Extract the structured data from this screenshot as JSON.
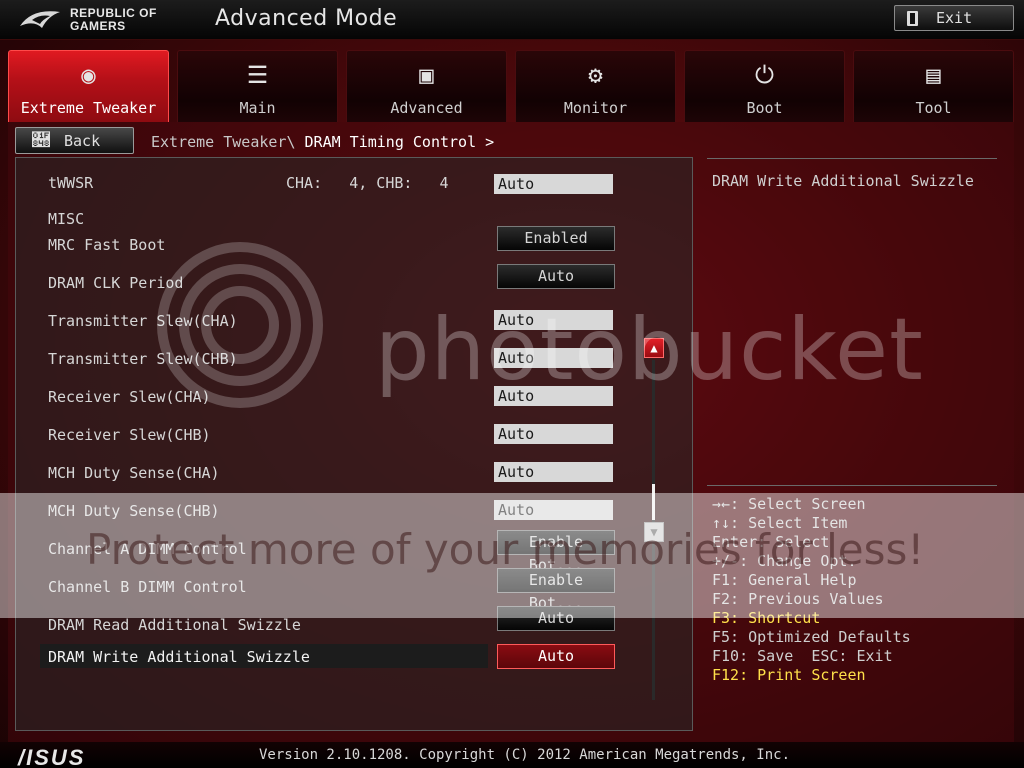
{
  "header": {
    "brand_line1": "REPUBLIC OF",
    "brand_line2": "GAMERS",
    "mode_title": "Advanced Mode",
    "exit_label": "Exit"
  },
  "tabs": [
    {
      "label": "Extreme Tweaker",
      "icon": "tweaker-icon",
      "active": true
    },
    {
      "label": "Main",
      "icon": "list-icon",
      "active": false
    },
    {
      "label": "Advanced",
      "icon": "advanced-icon",
      "active": false
    },
    {
      "label": "Monitor",
      "icon": "gauge-icon",
      "active": false
    },
    {
      "label": "Boot",
      "icon": "power-icon",
      "active": false
    },
    {
      "label": "Tool",
      "icon": "toolbox-icon",
      "active": false
    }
  ],
  "nav": {
    "back_label": "Back",
    "breadcrumb_parent": "Extreme Tweaker\\",
    "breadcrumb_current": "DRAM Timing Control >"
  },
  "settings": {
    "twwsr": {
      "label": "tWWSR",
      "cha_chb": "CHA:   4, CHB:   4",
      "value": "Auto"
    },
    "misc_heading": "MISC",
    "rows": [
      {
        "label": "MRC Fast Boot",
        "value": "Enabled"
      },
      {
        "label": "DRAM CLK Period",
        "value": "Auto"
      },
      {
        "label": "Transmitter Slew(CHA)",
        "value": "Auto"
      },
      {
        "label": "Transmitter Slew(CHB)",
        "value": "Auto"
      },
      {
        "label": "Receiver Slew(CHA)",
        "value": "Auto"
      },
      {
        "label": "Receiver Slew(CHB)",
        "value": "Auto"
      },
      {
        "label": "MCH Duty Sense(CHA)",
        "value": "Auto"
      },
      {
        "label": "MCH Duty Sense(CHB)",
        "value": "Auto"
      },
      {
        "label": "Channel A DIMM Control",
        "value": "Enable Bot..."
      },
      {
        "label": "Channel B DIMM Control",
        "value": "Enable Bot..."
      },
      {
        "label": "DRAM Read Additional Swizzle",
        "value": "Auto"
      },
      {
        "label": "DRAM Write Additional Swizzle",
        "value": "Auto"
      }
    ]
  },
  "help": {
    "description": "DRAM Write Additional Swizzle",
    "keys": [
      "→←: Select Screen",
      "↑↓: Select Item",
      "Enter: Select",
      "+/-: Change Opt.",
      "F1: General Help",
      "F2: Previous Values",
      "F3: Shortcut",
      "F5: Optimized Defaults",
      "F10: Save  ESC: Exit",
      "F12: Print Screen"
    ]
  },
  "watermark": {
    "logo": "photobucket",
    "text": "Protect more of your memories for less!"
  },
  "footer": {
    "brand": "/ISUS",
    "version": "Version 2.10.1208. Copyright (C) 2012 American Megatrends, Inc."
  },
  "colors": {
    "accent": "#d0141c",
    "highlight_key": "#ffe14a"
  }
}
